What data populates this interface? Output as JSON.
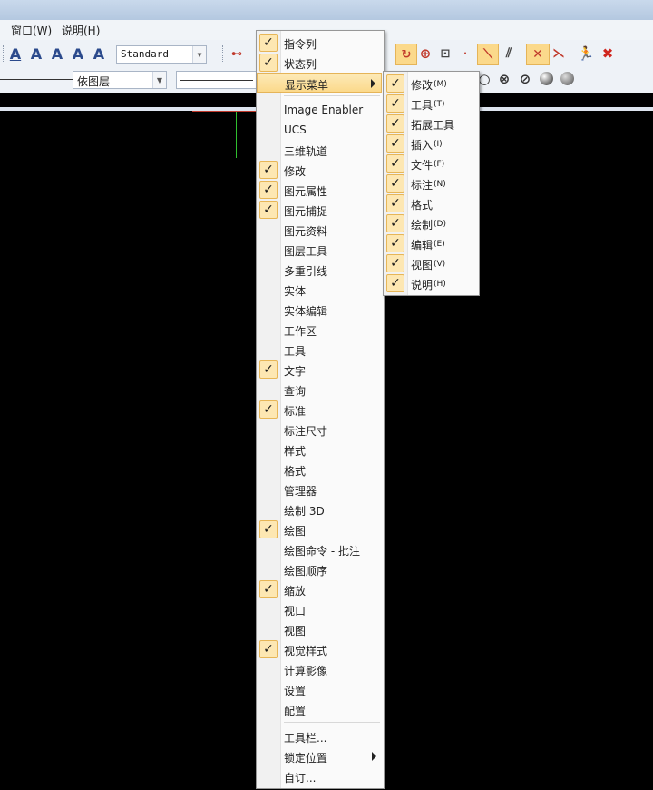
{
  "menubar": {
    "window": "窗口(W)",
    "help": "说明(H)"
  },
  "toolbar": {
    "text_style_value": "Standard",
    "layer_value": "依图层",
    "glyph_text": "A"
  },
  "context_menu": {
    "top_items": [
      {
        "label": "指令列",
        "checked": true
      },
      {
        "label": "状态列",
        "checked": true
      }
    ],
    "highlighted": {
      "label": "显示菜单",
      "checked": false
    },
    "items": [
      {
        "label": "Image Enabler",
        "checked": false
      },
      {
        "label": "UCS",
        "checked": false
      },
      {
        "label": "三维轨道",
        "checked": false
      },
      {
        "label": "修改",
        "checked": true
      },
      {
        "label": "图元属性",
        "checked": true
      },
      {
        "label": "图元捕捉",
        "checked": true
      },
      {
        "label": "图元资料",
        "checked": false
      },
      {
        "label": "图层工具",
        "checked": false
      },
      {
        "label": "多重引线",
        "checked": false
      },
      {
        "label": "实体",
        "checked": false
      },
      {
        "label": "实体编辑",
        "checked": false
      },
      {
        "label": "工作区",
        "checked": false
      },
      {
        "label": "工具",
        "checked": false
      },
      {
        "label": "文字",
        "checked": true
      },
      {
        "label": "查询",
        "checked": false
      },
      {
        "label": "标准",
        "checked": true
      },
      {
        "label": "标注尺寸",
        "checked": false
      },
      {
        "label": "样式",
        "checked": false
      },
      {
        "label": "格式",
        "checked": false
      },
      {
        "label": "管理器",
        "checked": false
      },
      {
        "label": "绘制 3D",
        "checked": false
      },
      {
        "label": "绘图",
        "checked": true
      },
      {
        "label": "绘图命令 - 批注",
        "checked": false
      },
      {
        "label": "绘图顺序",
        "checked": false
      },
      {
        "label": "缩放",
        "checked": true
      },
      {
        "label": "视口",
        "checked": false
      },
      {
        "label": "视图",
        "checked": false
      },
      {
        "label": "视觉样式",
        "checked": true
      },
      {
        "label": "计算影像",
        "checked": false
      },
      {
        "label": "设置",
        "checked": false
      },
      {
        "label": "配置",
        "checked": false
      }
    ],
    "bottom_items": [
      {
        "label": "工具栏..."
      },
      {
        "label": "锁定位置"
      },
      {
        "label": "自订..."
      }
    ]
  },
  "submenu": {
    "items": [
      {
        "label": "修改",
        "key": "(M)",
        "checked": true
      },
      {
        "label": "工具",
        "key": "(T)",
        "checked": true
      },
      {
        "label": "拓展工具",
        "key": "",
        "checked": true
      },
      {
        "label": "插入",
        "key": "(I)",
        "checked": true
      },
      {
        "label": "文件",
        "key": "(F)",
        "checked": true
      },
      {
        "label": "标注",
        "key": "(N)",
        "checked": true
      },
      {
        "label": "格式",
        "key": "",
        "checked": true
      },
      {
        "label": "绘制",
        "key": "(D)",
        "checked": true
      },
      {
        "label": "编辑",
        "key": "(E)",
        "checked": true
      },
      {
        "label": "视图",
        "key": "(V)",
        "checked": true
      },
      {
        "label": "说明",
        "key": "(H)",
        "checked": true
      }
    ]
  },
  "check_glyph": "✓",
  "colors": {
    "accent_highlight": "#fbd98b",
    "check_bg": "#fde7b2",
    "canvas": "#000000"
  }
}
